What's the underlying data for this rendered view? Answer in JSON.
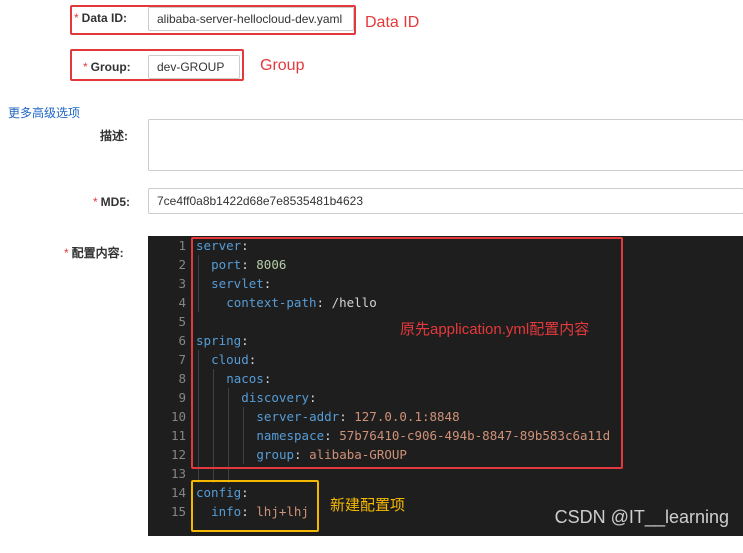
{
  "form": {
    "data_id": {
      "required_mark": "*",
      "label": "Data ID:",
      "value": "alibaba-server-hellocloud-dev.yaml"
    },
    "group": {
      "required_mark": "*",
      "label": "Group:",
      "value": "dev-GROUP"
    },
    "advanced_link": "更多高级选项",
    "description": {
      "label": "描述:",
      "value": ""
    },
    "md5": {
      "required_mark": "*",
      "label": "MD5:",
      "value": "7ce4ff0a8b1422d68e7e8535481b4623"
    },
    "content": {
      "required_mark": "*",
      "label": "配置内容:"
    }
  },
  "annotations": {
    "data_id": "Data ID",
    "group": "Group",
    "original_content": "原先application.yml配置内容",
    "new_item": "新建配置项"
  },
  "editor": {
    "line_numbers": [
      "1",
      "2",
      "3",
      "4",
      "5",
      "6",
      "7",
      "8",
      "9",
      "10",
      "11",
      "12",
      "13",
      "14",
      "15"
    ],
    "lines": [
      {
        "key": "server",
        "sep": ":",
        "value": "",
        "vtype": ""
      },
      {
        "key": "port",
        "sep": ": ",
        "value": "8006",
        "vtype": "num"
      },
      {
        "key": "servlet",
        "sep": ":",
        "value": "",
        "vtype": ""
      },
      {
        "key": "context-path",
        "sep": ": ",
        "value": "/hello",
        "vtype": "plain"
      },
      {
        "key": "",
        "sep": "",
        "value": "",
        "vtype": ""
      },
      {
        "key": "spring",
        "sep": ":",
        "value": "",
        "vtype": ""
      },
      {
        "key": "cloud",
        "sep": ":",
        "value": "",
        "vtype": ""
      },
      {
        "key": "nacos",
        "sep": ":",
        "value": "",
        "vtype": ""
      },
      {
        "key": "discovery",
        "sep": ":",
        "value": "",
        "vtype": ""
      },
      {
        "key": "server-addr",
        "sep": ": ",
        "value": "127.0.0.1:8848",
        "vtype": "str"
      },
      {
        "key": "namespace",
        "sep": ": ",
        "value": "57b76410-c906-494b-8847-89b583c6a11d",
        "vtype": "str"
      },
      {
        "key": "group",
        "sep": ": ",
        "value": "alibaba-GROUP",
        "vtype": "str"
      },
      {
        "key": "",
        "sep": "",
        "value": "",
        "vtype": ""
      },
      {
        "key": "config",
        "sep": ":",
        "value": "",
        "vtype": ""
      },
      {
        "key": "info",
        "sep": ": ",
        "value": "lhj+lhj",
        "vtype": "str"
      }
    ]
  },
  "watermark": "CSDN @IT__learning",
  "colors": {
    "annotation_red": "#e4393c",
    "annotation_yellow": "#f5b800",
    "editor_bg": "#1e1e1e",
    "yaml_key": "#569cd6",
    "yaml_number": "#b5cea8",
    "yaml_string": "#ce9178"
  }
}
